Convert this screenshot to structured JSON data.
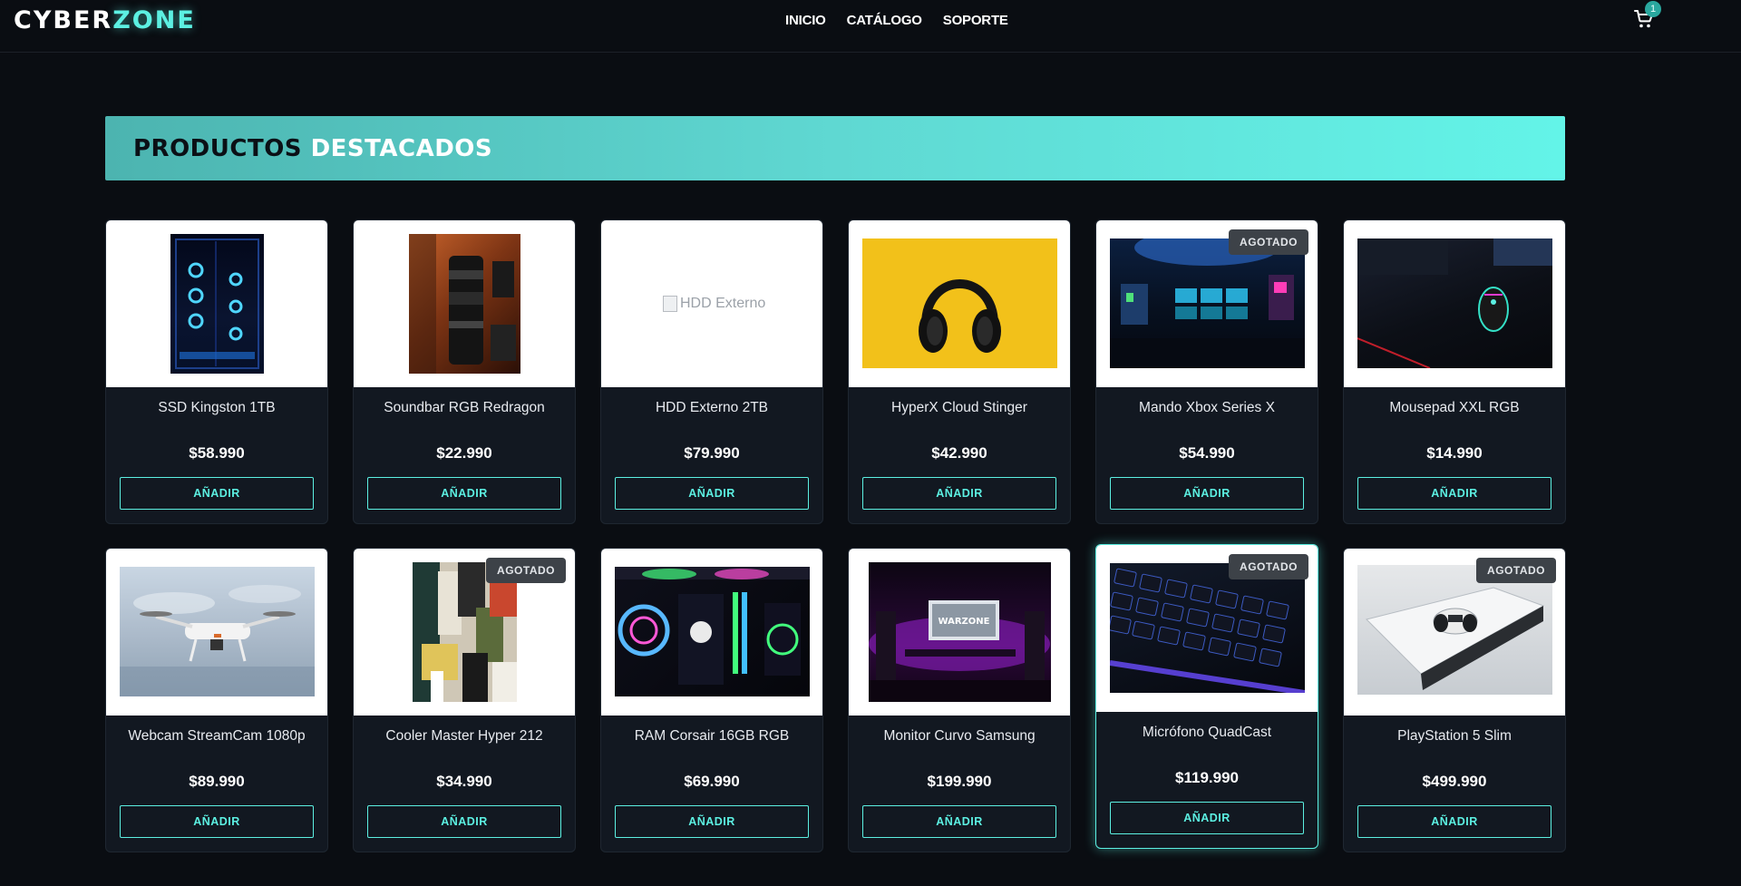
{
  "brand": {
    "part1": "CYBER",
    "part2": "ZONE"
  },
  "nav": {
    "links": [
      "INICIO",
      "CATÁLOGO",
      "SOPORTE"
    ]
  },
  "cart": {
    "count": "1",
    "icon": "cart-icon"
  },
  "banner": {
    "title_dark": "PRODUCTOS",
    "title_light": "DESTACADOS"
  },
  "products": [
    {
      "name": "SSD Kingston 1TB",
      "price": "$58.990",
      "sold_out": false,
      "button": "AÑADIR"
    },
    {
      "name": "Soundbar RGB Redragon",
      "price": "$22.990",
      "sold_out": false,
      "button": "AÑADIR"
    },
    {
      "name": "HDD Externo 2TB",
      "price": "$79.990",
      "sold_out": false,
      "button": "AÑADIR",
      "image_alt": "HDD Externo"
    },
    {
      "name": "HyperX Cloud Stinger",
      "price": "$42.990",
      "sold_out": false,
      "button": "AÑADIR"
    },
    {
      "name": "Mando Xbox Series X",
      "price": "$54.990",
      "sold_out": true,
      "badge": "AGOTADO",
      "button": "AÑADIR"
    },
    {
      "name": "Mousepad XXL RGB",
      "price": "$14.990",
      "sold_out": false,
      "button": "AÑADIR"
    },
    {
      "name": "Webcam StreamCam 1080p",
      "price": "$89.990",
      "sold_out": false,
      "button": "AÑADIR"
    },
    {
      "name": "Cooler Master Hyper 212",
      "price": "$34.990",
      "sold_out": true,
      "badge": "AGOTADO",
      "button": "AÑADIR"
    },
    {
      "name": "RAM Corsair 16GB RGB",
      "price": "$69.990",
      "sold_out": false,
      "button": "AÑADIR"
    },
    {
      "name": "Monitor Curvo Samsung",
      "price": "$199.990",
      "sold_out": false,
      "button": "AÑADIR",
      "image_text": "WARZONE"
    },
    {
      "name": "Micrófono QuadCast",
      "price": "$119.990",
      "sold_out": true,
      "badge": "AGOTADO",
      "button": "AÑADIR",
      "highlighted": true
    },
    {
      "name": "PlayStation 5 Slim",
      "price": "$499.990",
      "sold_out": true,
      "badge": "AGOTADO",
      "button": "AÑADIR"
    }
  ],
  "colors": {
    "accent": "#5cf0e2",
    "background": "#0a0d12",
    "card": "#121821",
    "badge": "#3d4248"
  }
}
